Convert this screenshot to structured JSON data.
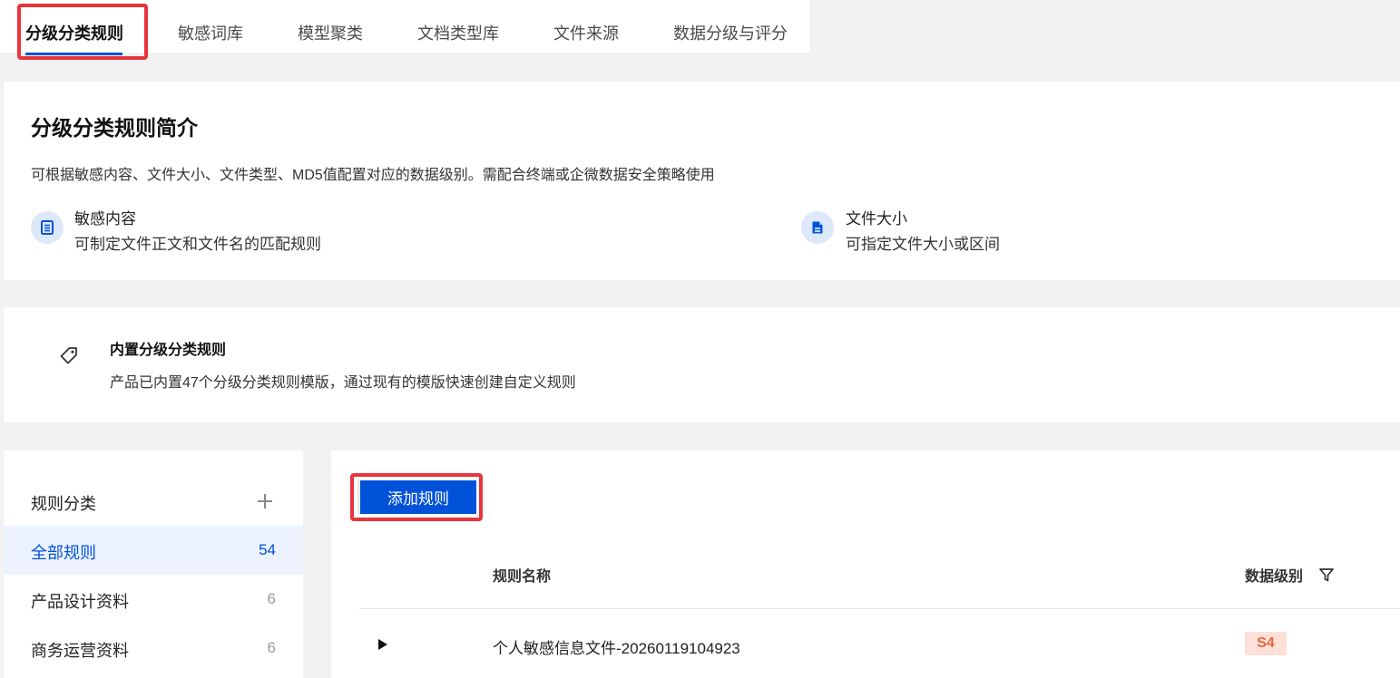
{
  "tabs": [
    {
      "label": "分级分类规则",
      "active": true
    },
    {
      "label": "敏感词库"
    },
    {
      "label": "模型聚类"
    },
    {
      "label": "文档类型库"
    },
    {
      "label": "文件来源"
    },
    {
      "label": "数据分级与评分"
    }
  ],
  "intro": {
    "title": "分级分类规则简介",
    "description": "可根据敏感内容、文件大小、文件类型、MD5值配置对应的数据级别。需配合终端或企微数据安全策略使用",
    "features": [
      {
        "icon": "document-list-icon",
        "title": "敏感内容",
        "desc": "可制定文件正文和文件名的匹配规则"
      },
      {
        "icon": "file-size-icon",
        "title": "文件大小",
        "desc": "可指定文件大小或区间"
      }
    ]
  },
  "builtin": {
    "icon": "tag-icon",
    "title": "内置分级分类规则",
    "desc": "产品已内置47个分级分类规则模版，通过现有的模版快速创建自定义规则"
  },
  "sidebar": {
    "header": "规则分类",
    "add_icon": "plus-icon",
    "items": [
      {
        "label": "全部规则",
        "count": "54",
        "active": true
      },
      {
        "label": "产品设计资料",
        "count": "6"
      },
      {
        "label": "商务运营资料",
        "count": "6"
      }
    ]
  },
  "toolbar": {
    "add_label": "添加规则"
  },
  "table": {
    "columns": {
      "name": "规则名称",
      "level": "数据级别"
    },
    "filter_icon": "filter-icon",
    "rows": [
      {
        "expand_icon": "caret-right-icon",
        "name": "个人敏感信息文件-20260119104923",
        "level": "S4"
      }
    ]
  },
  "colors": {
    "primary": "#0052d9",
    "highlight": "#e8353c",
    "badge_bg": "#fde0d7",
    "badge_text": "#e5673f"
  }
}
